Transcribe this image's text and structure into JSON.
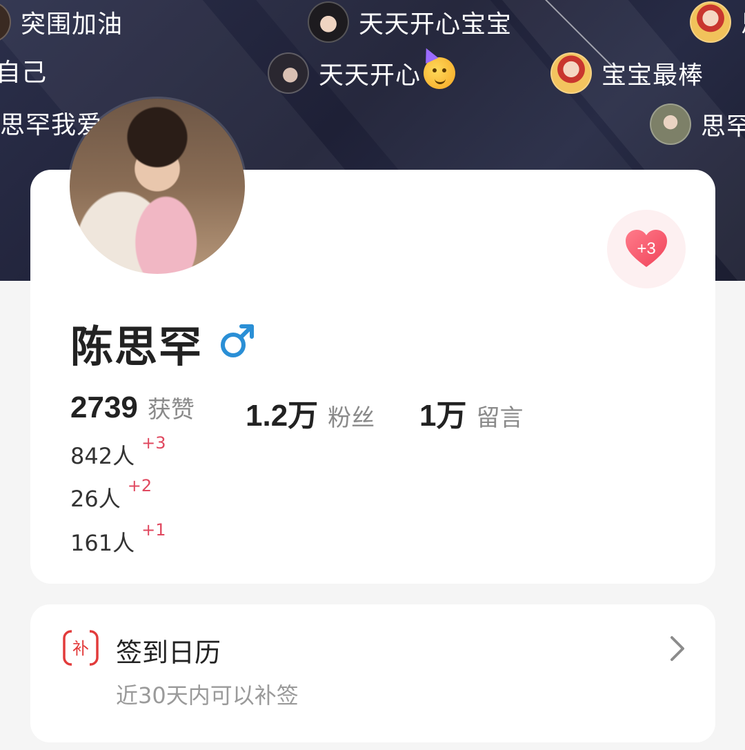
{
  "danmu": [
    {
      "text": "突围加油"
    },
    {
      "text": "天天开心宝宝"
    },
    {
      "text": "思"
    },
    {
      "text": "自己"
    },
    {
      "text": "天天开心"
    },
    {
      "text": "宝宝最棒"
    },
    {
      "text": "思罕我爱"
    },
    {
      "text": "思罕"
    }
  ],
  "profile": {
    "name": "陈思罕",
    "gender_symbol": "♂",
    "like_button_badge": "+3",
    "stats": [
      {
        "num": "2739",
        "label": "获赞"
      },
      {
        "num": "1.2万",
        "label": "粉丝"
      },
      {
        "num": "1万",
        "label": "留言"
      }
    ],
    "sub_stats": [
      {
        "count": "842人",
        "delta": "+3"
      },
      {
        "count": "26人",
        "delta": "+2"
      },
      {
        "count": "161人",
        "delta": "+1"
      }
    ]
  },
  "checkin": {
    "icon_text": "补",
    "title": "签到日历",
    "description": "近30天内可以补签"
  },
  "colors": {
    "banner_bg": "#1e2036",
    "accent_red": "#e0485f",
    "gender_blue": "#2a8fd6",
    "card_bg": "#ffffff",
    "page_bg": "#f5f5f5"
  },
  "icons": [
    "party-emoji",
    "heart-icon",
    "male-icon",
    "checkin-icon",
    "chevron-right-icon"
  ]
}
